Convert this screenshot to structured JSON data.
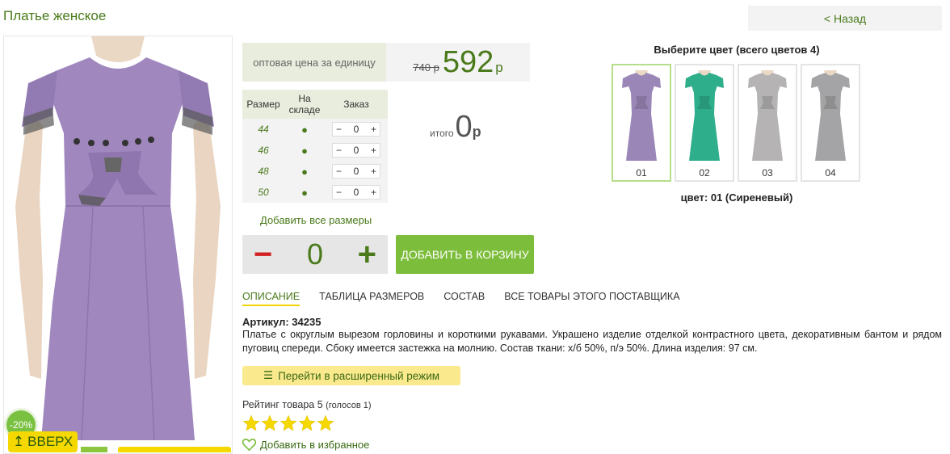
{
  "product_title": "Платье женское",
  "back_label": "< Назад",
  "price": {
    "label": "оптовая цена за единицу",
    "old": "740 р",
    "current": "592",
    "currency": "р"
  },
  "size_table": {
    "headers": [
      "Размер",
      "На складе",
      "Заказ"
    ],
    "rows": [
      {
        "size": "44",
        "stock": "●",
        "qty": "0"
      },
      {
        "size": "46",
        "stock": "●",
        "qty": "0"
      },
      {
        "size": "48",
        "stock": "●",
        "qty": "0"
      },
      {
        "size": "50",
        "stock": "●",
        "qty": "0"
      }
    ]
  },
  "total": {
    "label": "итого",
    "value": "0",
    "currency": "р"
  },
  "add_all_sizes": "Добавить все размеры",
  "stepper": {
    "minus": "−",
    "value": "0",
    "plus": "+"
  },
  "add_to_cart": "ДОБАВИТЬ В КОРЗИНУ",
  "tabs": [
    "ОПИСАНИЕ",
    "ТАБЛИЦА РАЗМЕРОВ",
    "СОСТАВ",
    "ВСЕ ТОВАРЫ ЭТОГО ПОСТАВЩИКА"
  ],
  "article": "Артикул: 34235",
  "description": "Платье с округлым вырезом горловины и короткими рукавами. Украшено изделие отделкой контрастного цвета, декоративным бантом и рядом  пуговиц спереди. Сбоку имеется застежка на молнию. Состав ткани: х/б 50%, п/э 50%. Длина изделия: 97 см.",
  "extended_mode": "Перейти в расширенный режим",
  "rating": {
    "text": "Рейтинг товара 5",
    "votes": "(голосов 1)",
    "stars": 5
  },
  "favorite": "Добавить в избранное",
  "discount_badge": "-20%",
  "scroll_up": "ВВЕРХ",
  "colors": {
    "heading": "Выберите цвет (всего цветов 4)",
    "selected_label": "цвет: 01 (Сиреневый)",
    "items": [
      {
        "num": "01",
        "color": "#9b86b8"
      },
      {
        "num": "02",
        "color": "#2fae8c"
      },
      {
        "num": "03",
        "color": "#b5b3b3"
      },
      {
        "num": "04",
        "color": "#a4a4a6"
      }
    ]
  },
  "accent": {
    "green": "#4a7a1b",
    "button_green": "#7dbd3c",
    "yellow": "#f5d800",
    "dress": "#a088bf"
  }
}
